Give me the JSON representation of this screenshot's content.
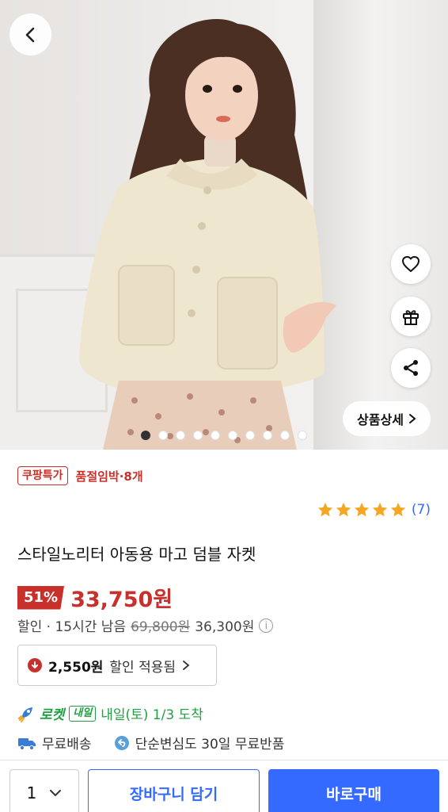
{
  "hero": {
    "image_alt": "product-photo",
    "detail_button_label": "상품상세",
    "dots_total": 10,
    "dots_active_index": 0
  },
  "badge": {
    "label": "쿠팡특가",
    "stock_text": "품절임박·8개"
  },
  "rating": {
    "stars": 5,
    "count_text": "(7)",
    "star_color": "#f5a623"
  },
  "product": {
    "title": "스타일노리터 아동용 마고 덤블 자켓"
  },
  "price": {
    "discount_rate": "51%",
    "sale_price": "33,750원",
    "discount_label": "할인 · 15시간 남음",
    "original_price": "69,800원",
    "previous_price": "36,300원"
  },
  "coupon": {
    "amount": "2,550원",
    "text": "할인 적용됨"
  },
  "delivery": {
    "rocket_label": "로켓",
    "tomorrow_badge": "내일",
    "arrival_text": "내일(토) 1/3 도착",
    "free_shipping": "무료배송",
    "free_return": "단순변심도 30일 무료반품"
  },
  "bottom_bar": {
    "quantity": "1",
    "cart_label": "장바구니 담기",
    "buy_label": "바로구매"
  },
  "colors": {
    "accent_red": "#c8312b",
    "accent_blue": "#346aff",
    "rocket_green": "#20a040"
  }
}
